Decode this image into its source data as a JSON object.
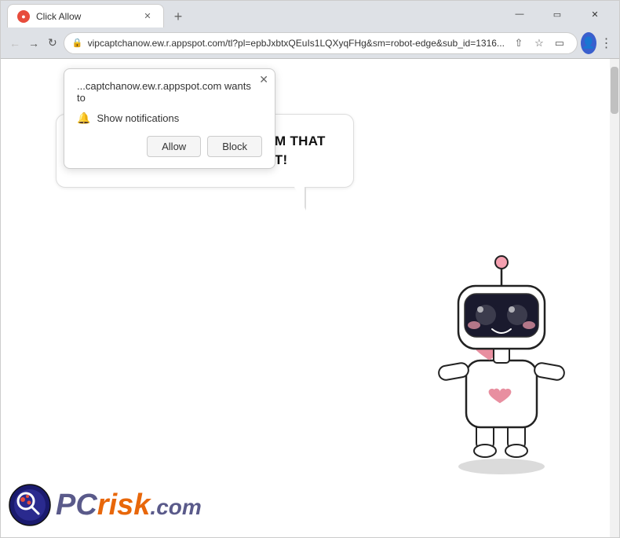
{
  "browser": {
    "title_bar": {
      "tab_title": "Click Allow",
      "tab_favicon": "C",
      "new_tab_label": "+",
      "window_controls": {
        "minimize": "—",
        "restore": "❐",
        "close": "✕"
      }
    },
    "address_bar": {
      "url": "vipcaptchanow.ew.r.appspot.com/tl?pl=epbJxbtxQEuIs1LQXyqFHg&sm=robot-edge&sub_id=1316...",
      "back_label": "←",
      "forward_label": "→",
      "refresh_label": "↻",
      "star_label": "☆"
    }
  },
  "popup": {
    "url_text": "...captchanow.ew.r.appspot.com wants to",
    "notification_label": "Show notifications",
    "close_label": "✕",
    "allow_button": "Allow",
    "block_button": "Block"
  },
  "page": {
    "bubble_text": "CLICK «ALLOW» TO CONFIRM THAT YOU ARE NOT A ROBOT!",
    "brand": {
      "pc_text": "PC",
      "risk_text": "risk",
      "com_text": ".com"
    }
  }
}
